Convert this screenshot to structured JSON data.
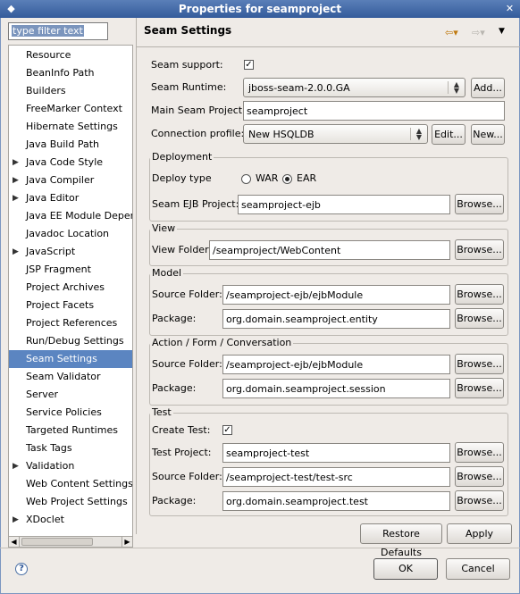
{
  "window": {
    "title": "Properties for seamproject"
  },
  "filter": {
    "placeholder": "type filter text"
  },
  "tree": [
    {
      "label": "Resource",
      "expandable": false
    },
    {
      "label": "BeanInfo Path",
      "expandable": false
    },
    {
      "label": "Builders",
      "expandable": false
    },
    {
      "label": "FreeMarker Context",
      "expandable": false
    },
    {
      "label": "Hibernate Settings",
      "expandable": false
    },
    {
      "label": "Java Build Path",
      "expandable": false
    },
    {
      "label": "Java Code Style",
      "expandable": true
    },
    {
      "label": "Java Compiler",
      "expandable": true
    },
    {
      "label": "Java Editor",
      "expandable": true
    },
    {
      "label": "Java EE Module Depend",
      "expandable": false
    },
    {
      "label": "Javadoc Location",
      "expandable": false
    },
    {
      "label": "JavaScript",
      "expandable": true
    },
    {
      "label": "JSP Fragment",
      "expandable": false
    },
    {
      "label": "Project Archives",
      "expandable": false
    },
    {
      "label": "Project Facets",
      "expandable": false
    },
    {
      "label": "Project References",
      "expandable": false
    },
    {
      "label": "Run/Debug Settings",
      "expandable": false
    },
    {
      "label": "Seam Settings",
      "expandable": false,
      "selected": true
    },
    {
      "label": "Seam Validator",
      "expandable": false
    },
    {
      "label": "Server",
      "expandable": false
    },
    {
      "label": "Service Policies",
      "expandable": false
    },
    {
      "label": "Targeted Runtimes",
      "expandable": false
    },
    {
      "label": "Task Tags",
      "expandable": false
    },
    {
      "label": "Validation",
      "expandable": true
    },
    {
      "label": "Web Content Settings",
      "expandable": false
    },
    {
      "label": "Web Project Settings",
      "expandable": false
    },
    {
      "label": "XDoclet",
      "expandable": true
    }
  ],
  "page": {
    "title": "Seam Settings",
    "seam_support_label": "Seam support:",
    "seam_runtime_label": "Seam Runtime:",
    "seam_runtime_value": "jboss-seam-2.0.0.GA",
    "add_label": "Add...",
    "main_project_label": "Main Seam Project:",
    "main_project_value": "seamproject",
    "connection_label": "Connection profile:",
    "connection_value": "New HSQLDB",
    "edit_label": "Edit...",
    "new_label": "New...",
    "browse_label": "Browse...",
    "deployment": {
      "title": "Deployment",
      "deploy_type_label": "Deploy type",
      "war_label": "WAR",
      "ear_label": "EAR",
      "ejb_project_label": "Seam EJB Project:",
      "ejb_project_value": "seamproject-ejb"
    },
    "view": {
      "title": "View",
      "folder_label": "View Folder:",
      "folder_value": "/seamproject/WebContent"
    },
    "model": {
      "title": "Model",
      "source_label": "Source Folder:",
      "source_value": "/seamproject-ejb/ejbModule",
      "package_label": "Package:",
      "package_value": "org.domain.seamproject.entity"
    },
    "action": {
      "title": "Action / Form / Conversation",
      "source_label": "Source Folder:",
      "source_value": "/seamproject-ejb/ejbModule",
      "package_label": "Package:",
      "package_value": "org.domain.seamproject.session"
    },
    "test": {
      "title": "Test",
      "create_label": "Create Test:",
      "project_label": "Test Project:",
      "project_value": "seamproject-test",
      "source_label": "Source Folder:",
      "source_value": "/seamproject-test/test-src",
      "package_label": "Package:",
      "package_value": "org.domain.seamproject.test"
    },
    "restore_label": "Restore Defaults",
    "apply_label": "Apply"
  },
  "footer": {
    "ok_label": "OK",
    "cancel_label": "Cancel"
  }
}
